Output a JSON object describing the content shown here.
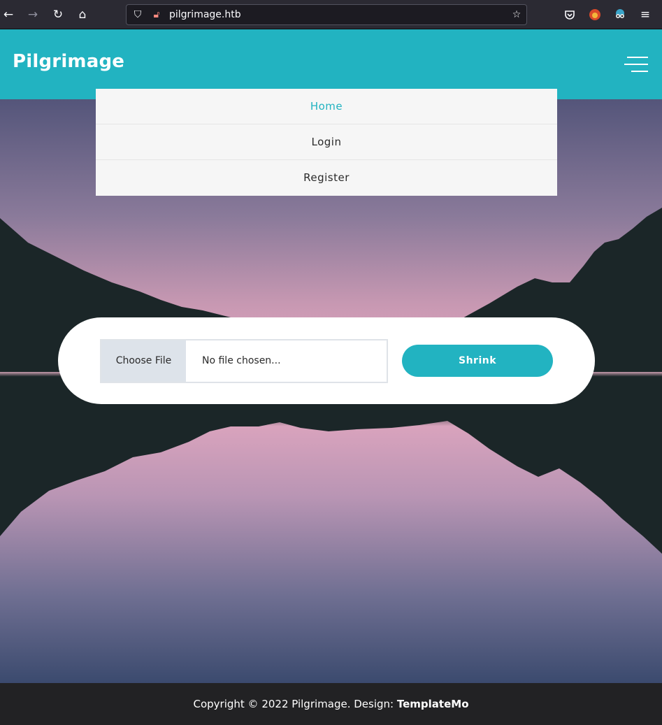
{
  "browser": {
    "url": "pilgrimage.htb",
    "icons": {
      "back": "arrow-left-icon",
      "forward": "arrow-right-icon",
      "reload": "reload-icon",
      "home": "home-icon",
      "shield": "shield-icon",
      "lock": "lock-warning-icon",
      "bookmark": "star-icon",
      "pocket": "pocket-icon",
      "extension1": "extension-icon",
      "extension2": "extension-icon",
      "menu": "menu-icon"
    }
  },
  "header": {
    "brand": "Pilgrimage",
    "accent_color": "#22b3c1"
  },
  "menu": {
    "items": [
      {
        "label": "Home",
        "active": true
      },
      {
        "label": "Login",
        "active": false
      },
      {
        "label": "Register",
        "active": false
      }
    ]
  },
  "upload": {
    "choose_label": "Choose File",
    "file_status": "No file chosen...",
    "submit_label": "Shrink"
  },
  "footer": {
    "text": "Copyright © 2022 Pilgrimage. Design: ",
    "link_label": "TemplateMo"
  }
}
